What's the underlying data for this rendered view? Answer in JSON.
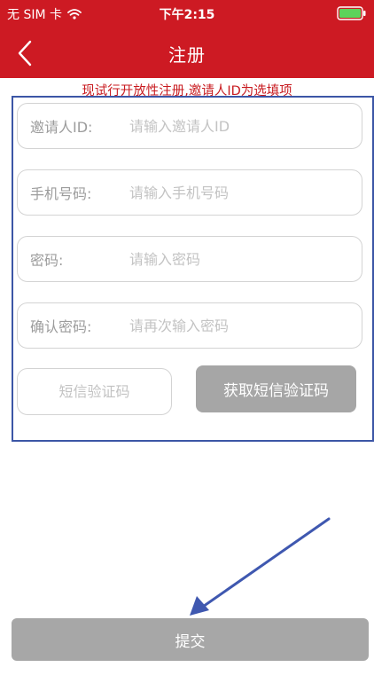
{
  "status_bar": {
    "carrier": "无 SIM 卡",
    "time": "下午2:15"
  },
  "nav": {
    "title": "注册",
    "back_icon": "chevron-left-icon"
  },
  "notice": "现试行开放性注册,邀请人ID为选填项",
  "form": {
    "fields": [
      {
        "label": "邀请人ID:",
        "placeholder": "请输入邀请人ID"
      },
      {
        "label": "手机号码:",
        "placeholder": "请输入手机号码"
      },
      {
        "label": "密码:",
        "placeholder": "请输入密码"
      },
      {
        "label": "确认密码:",
        "placeholder": "请再次输入密码"
      }
    ],
    "sms_code_placeholder": "短信验证码",
    "get_code_label": "获取短信验证码"
  },
  "submit_label": "提交",
  "colors": {
    "header": "#cd1a23",
    "notice": "#c81a1f",
    "frame": "#3c56a6",
    "button_disabled": "#a6a6a6"
  }
}
